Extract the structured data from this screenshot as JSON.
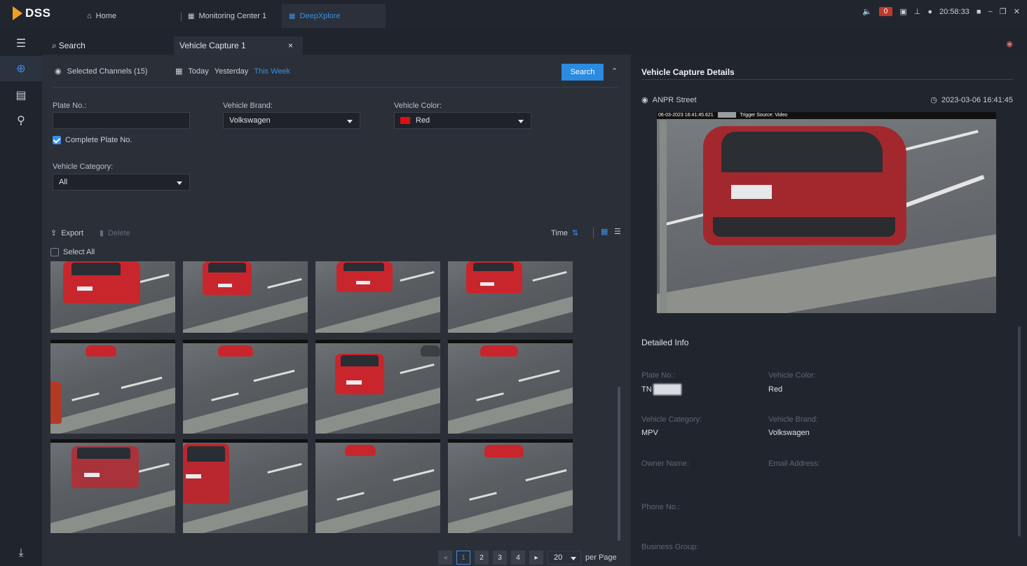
{
  "app": {
    "logo": "DSS",
    "tabs": [
      {
        "label": "Home",
        "icon": "home-icon"
      },
      {
        "label": "Monitoring Center 1",
        "icon": "grid-icon"
      },
      {
        "label": "DeepXplore",
        "icon": "grid-icon"
      }
    ],
    "alarm_count": "0",
    "clock": "20:58:33"
  },
  "subtabs": {
    "search_label": "Search",
    "capture_label": "Vehicle Capture 1",
    "close": "×"
  },
  "filters": {
    "channels": "Selected Channels (15)",
    "today": "Today",
    "yesterday": "Yesterday",
    "this_week": "This Week",
    "search_button": "Search",
    "plate_label": "Plate No.:",
    "plate_value": "",
    "brand_label": "Vehicle Brand:",
    "brand_value": "Volkswagen",
    "color_label": "Vehicle Color:",
    "color_value": "Red",
    "complete_plate": "Complete Plate No.",
    "category_label": "Vehicle Category:",
    "category_value": "All"
  },
  "results": {
    "export": "Export",
    "delete": "Delete",
    "select_all": "Select All",
    "sort": "Time",
    "pages": [
      "1",
      "2",
      "3",
      "4"
    ],
    "per_page_value": "20",
    "per_page_label": "per Page"
  },
  "details": {
    "title": "Vehicle Capture Details",
    "location": "ANPR Street",
    "timestamp": "2023-03-06 16:41:45",
    "banner_text": "06-03-2023 16:41:45.621",
    "banner_source": "Trigger Source: Video",
    "detailed_info": "Detailed Info",
    "plate_label": "Plate No.:",
    "plate_value": "TN",
    "color_label": "Vehicle Color:",
    "color_value": "Red",
    "category_label": "Vehicle Category:",
    "category_value": "MPV",
    "brand_label": "Vehicle Brand:",
    "brand_value": "Volkswagen",
    "owner_label": "Owner Name:",
    "email_label": "Email Address:",
    "phone_label": "Phone No.:",
    "group_label": "Business Group:"
  },
  "colors": {
    "accent": "#3a8fe6",
    "search_button": "#2a8be0",
    "vehicle_red": "#e01010",
    "alarm": "#c0392b"
  }
}
